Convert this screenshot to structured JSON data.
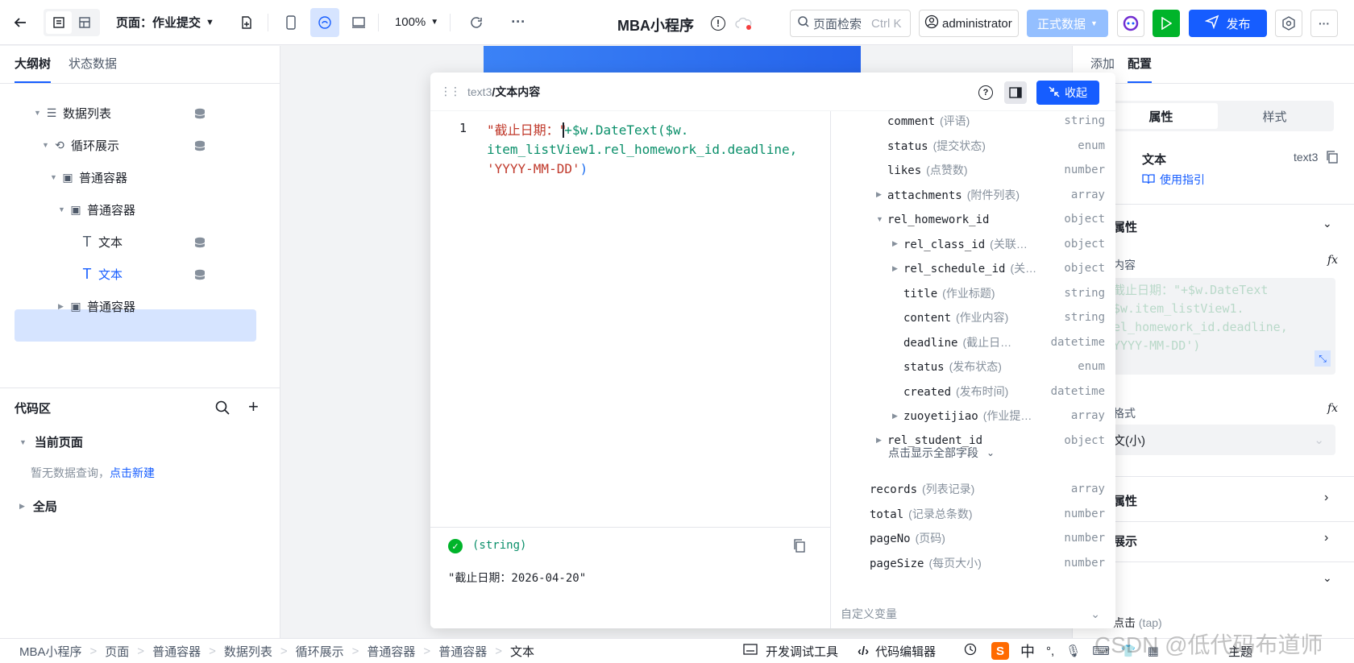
{
  "topbar": {
    "zoom": "100%",
    "page_selector": "页面：作业提交",
    "app_title": "MBA小程序",
    "search_label": "页面检索",
    "search_shortcut": "Ctrl K",
    "user": "administrator",
    "env": "正式数据",
    "publish": "发布"
  },
  "left": {
    "tabs": [
      "大纲树",
      "状态数据"
    ],
    "tree": [
      {
        "label": "数据列表"
      },
      {
        "label": "循环展示"
      },
      {
        "label": "普通容器"
      },
      {
        "label": "普通容器"
      },
      {
        "label": "文本"
      },
      {
        "label": "文本"
      },
      {
        "label": "普通容器"
      }
    ],
    "code_title": "代码区",
    "current_page": "当前页面",
    "empty_hint": "暂无数据查询，",
    "create_link": "点击新建",
    "global": "全局"
  },
  "modal": {
    "crumb_id": "text3",
    "crumb_title": "/文本内容",
    "collapse": "收起",
    "line_number": "1",
    "code_part1": "\"截止日期：\"",
    "code_part2": "+$w.DateText($w.",
    "code_part3": "item_listView1.rel_homework_id.deadline,",
    "code_part4": "'YYYY-MM-DD'",
    "code_part5": ")",
    "result_type": "(string)",
    "result_value": "\"截止日期：2026-04-20\"",
    "custom_vars": "自定义变量",
    "show_all": "点击显示全部字段",
    "fields": [
      {
        "name": "comment",
        "desc": "(评语)",
        "type": "string"
      },
      {
        "name": "status",
        "desc": "(提交状态)",
        "type": "enum"
      },
      {
        "name": "likes",
        "desc": "(点赞数)",
        "type": "number"
      },
      {
        "name": "attachments",
        "desc": "(附件列表)",
        "type": "array"
      },
      {
        "name": "rel_homework_id",
        "desc": "",
        "type": "object"
      },
      {
        "name": "rel_class_id",
        "desc": "(关联…",
        "type": "object"
      },
      {
        "name": "rel_schedule_id",
        "desc": "(关…",
        "type": "object"
      },
      {
        "name": "title",
        "desc": "(作业标题)",
        "type": "string"
      },
      {
        "name": "content",
        "desc": "(作业内容)",
        "type": "string"
      },
      {
        "name": "deadline",
        "desc": "(截止日…",
        "type": "datetime"
      },
      {
        "name": "status",
        "desc": "(发布状态)",
        "type": "enum"
      },
      {
        "name": "created",
        "desc": "(发布时间)",
        "type": "datetime"
      },
      {
        "name": "zuoyetijiao",
        "desc": "(作业提…",
        "type": "array"
      },
      {
        "name": "rel_student_id",
        "desc": "",
        "type": "object"
      },
      {
        "name": "records",
        "desc": "(列表记录)",
        "type": "array"
      },
      {
        "name": "total",
        "desc": "(记录总条数)",
        "type": "number"
      },
      {
        "name": "pageNo",
        "desc": "(页码)",
        "type": "number"
      },
      {
        "name": "pageSize",
        "desc": "(每页大小)",
        "type": "number"
      }
    ]
  },
  "right": {
    "tabs": [
      "添加",
      "配置"
    ],
    "seg": [
      "属性",
      "样式"
    ],
    "comp_name": "文本",
    "comp_id": "text3",
    "guide": "使用指引",
    "attr_title": "属性",
    "content_label": "内容",
    "content_preview": "截止日期：\"+$w.DateText\n$w.item_listView1.\nel_homework_id.deadline,\nYYYY-MM-DD')",
    "format_label": "格式",
    "format_value": "文(小)",
    "sec2": "属性",
    "sec3": "展示",
    "event": "点击",
    "event_sub": "(tap)"
  },
  "bottom": {
    "breadcrumb": [
      "MBA小程序",
      "页面",
      "普通容器",
      "数据列表",
      "循环展示",
      "普通容器",
      "普通容器",
      "文本"
    ],
    "devtools": "开发调试工具",
    "code_editor": "代码编辑器",
    "watermark": "CSDN @低代码布道师",
    "theme": "主题"
  },
  "colors": {
    "primary": "#165dff",
    "success": "#00b42a",
    "env_bg": "#94bfff"
  }
}
